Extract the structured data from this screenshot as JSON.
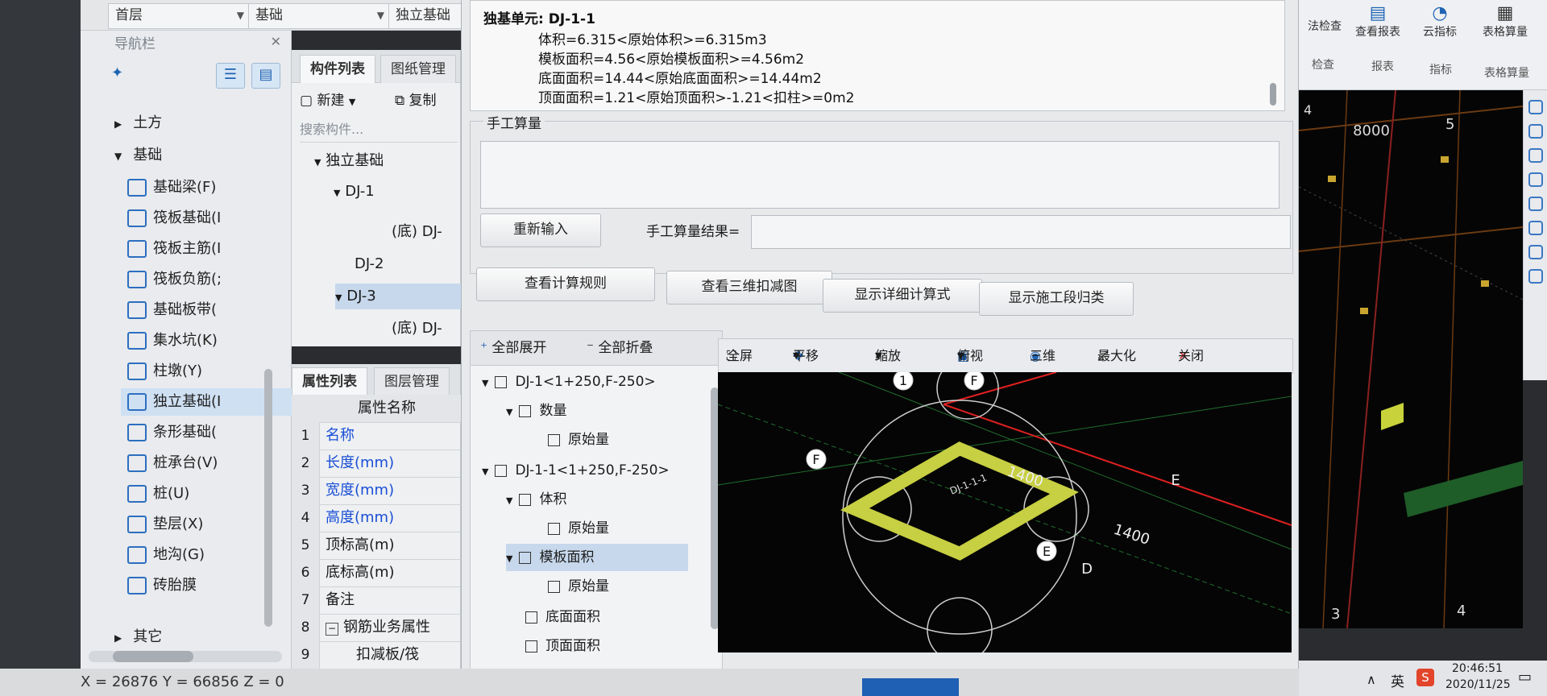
{
  "topbar": {
    "floor": "首层",
    "category": "基础",
    "type": "独立基础"
  },
  "nav": {
    "title": "导航栏",
    "groups": [
      {
        "label": "土方"
      },
      {
        "label": "基础"
      }
    ],
    "items": [
      {
        "label": "基础梁(F)"
      },
      {
        "label": "筏板基础(I"
      },
      {
        "label": "筏板主筋(I"
      },
      {
        "label": "筏板负筋(;"
      },
      {
        "label": "基础板带("
      },
      {
        "label": "集水坑(K)"
      },
      {
        "label": "柱墩(Y)"
      },
      {
        "label": "独立基础(I"
      },
      {
        "label": "条形基础("
      },
      {
        "label": "桩承台(V)"
      },
      {
        "label": "桩(U)"
      },
      {
        "label": "垫层(X)"
      },
      {
        "label": "地沟(G)"
      },
      {
        "label": "砖胎膜"
      }
    ],
    "other": "其它"
  },
  "components": {
    "tab_list": "构件列表",
    "tab_drawing": "图纸管理",
    "new_label": "新建",
    "copy_label": "复制",
    "search_placeholder": "搜索构件...",
    "tree": [
      {
        "label": "独立基础"
      },
      {
        "label": "DJ-1"
      },
      {
        "label": "(底) DJ-"
      },
      {
        "label": "DJ-2"
      },
      {
        "label": "DJ-3"
      },
      {
        "label": "(底) DJ-"
      }
    ]
  },
  "properties": {
    "tab_props": "属性列表",
    "tab_layers": "图层管理",
    "header": "属性名称",
    "rows": [
      {
        "num": "1",
        "name": "名称"
      },
      {
        "num": "2",
        "name": "长度(mm)"
      },
      {
        "num": "3",
        "name": "宽度(mm)"
      },
      {
        "num": "4",
        "name": "高度(mm)"
      },
      {
        "num": "5",
        "name": "顶标高(m)"
      },
      {
        "num": "6",
        "name": "底标高(m)"
      },
      {
        "num": "7",
        "name": "备注"
      },
      {
        "num": "8",
        "name": "钢筋业务属性"
      },
      {
        "num": "9",
        "name": "扣减板/筏"
      }
    ]
  },
  "calc": {
    "unit": "独基单元: DJ-1-1",
    "lines": [
      "体积=6.315<原始体积>=6.315m3",
      "模板面积=4.56<原始模板面积>=4.56m2",
      "底面面积=14.44<原始底面面积>=14.44m2",
      "顶面面积=1.21<原始顶面积>-1.21<扣柱>=0m2"
    ]
  },
  "manual": {
    "title": "手工算量",
    "reinput": "重新输入",
    "result_label": "手工算量结果="
  },
  "buttons": {
    "rules": "查看计算规则",
    "view3d": "查看三维扣减图",
    "detail": "显示详细计算式",
    "stage": "显示施工段归类"
  },
  "lower_tree": {
    "expand_all": "全部展开",
    "collapse_all": "全部折叠",
    "rows": [
      {
        "label": "DJ-1<1+250,F-250>"
      },
      {
        "label": "数量"
      },
      {
        "label": "原始量"
      },
      {
        "label": "DJ-1-1<1+250,F-250>"
      },
      {
        "label": "体积"
      },
      {
        "label": "原始量"
      },
      {
        "label": "模板面积"
      },
      {
        "label": "原始量"
      },
      {
        "label": "底面面积"
      },
      {
        "label": "顶面面积"
      }
    ]
  },
  "viewer": {
    "fullscreen": "全屏",
    "pan": "平移",
    "zoom": "缩放",
    "topview": "俯视",
    "threed": "三维",
    "maximize": "最大化",
    "close": "关闭",
    "labels": {
      "axis_1": "1",
      "axis_F_top": "F",
      "axis_F_left": "F",
      "axis_E": "E",
      "axis_D": "D",
      "axis_E_right": "E",
      "dim_1": "1400",
      "dim_2": "1400",
      "element": "DJ-1-1-1"
    }
  },
  "ribbon": {
    "check": "法检查",
    "report": "查看报表",
    "cloud": "云指标",
    "table": "表格算量",
    "group_check": "检查",
    "group_report": "报表",
    "group_index": "指标",
    "group_table": "表格算量"
  },
  "rview": {
    "dim": "8000",
    "axis_4_top": "4",
    "axis_5": "5",
    "axis_3": "3",
    "axis_4_bottom": "4"
  },
  "status": {
    "coords": "X = 26876 Y = 66856 Z = 0"
  },
  "tray": {
    "time": "20:46:51",
    "date": "2020/11/25",
    "ime": "英",
    "app": "S"
  }
}
